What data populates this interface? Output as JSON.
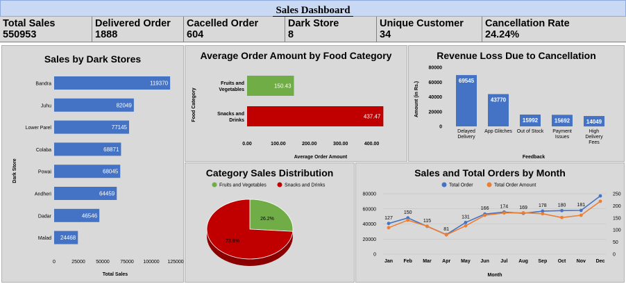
{
  "dashboard": {
    "title": "Sales Dashboard"
  },
  "kpis": [
    {
      "label": "Total Sales",
      "value": "550953"
    },
    {
      "label": "Delivered Order",
      "value": "1888"
    },
    {
      "label": "Cacelled Order",
      "value": "604"
    },
    {
      "label": "Dark Store",
      "value": "8"
    },
    {
      "label": "Unique Customer",
      "value": "34"
    },
    {
      "label": "Cancellation Rate",
      "value": "24.24%"
    }
  ],
  "colors": {
    "blue": "#4472c4",
    "red": "#c00000",
    "green": "#70ad47",
    "orange": "#ed7d31",
    "panel": "#d9d9d9",
    "title_bar": "#c9d9f3"
  },
  "chart_data": [
    {
      "id": "sales-by-dark-stores",
      "type": "bar",
      "orientation": "horizontal",
      "title": "Sales by Dark Stores",
      "xlabel": "Total Sales",
      "ylabel": "Dark Store",
      "categories": [
        "Bandra",
        "Juhu",
        "Lower Parel",
        "Colaba",
        "Powai",
        "Andheri",
        "Dadar",
        "Malad"
      ],
      "values": [
        119370,
        82049,
        77145,
        68871,
        68045,
        64459,
        46546,
        24468
      ],
      "xlim": [
        0,
        125000
      ],
      "xticks": [
        "0",
        "25000",
        "50000",
        "75000",
        "100000",
        "125000"
      ],
      "color": "#4472c4"
    },
    {
      "id": "avg-order-amount",
      "type": "bar",
      "orientation": "horizontal",
      "title": "Average Order Amount by Food Category",
      "xlabel": "Average Order Amount",
      "ylabel": "Food Category",
      "categories": [
        "Fruits and Vegetables",
        "Snacks and Drinks"
      ],
      "category_lines": [
        [
          "Fruits and",
          "Vegetables"
        ],
        [
          "Snacks and",
          "Drinks"
        ]
      ],
      "values": [
        150.43,
        437.47
      ],
      "value_labels": [
        "150.43",
        "437.47"
      ],
      "colors": [
        "#70ad47",
        "#c00000"
      ],
      "xlim": [
        0,
        450
      ],
      "xticks": [
        "0.00",
        "100.00",
        "200.00",
        "300.00",
        "400.00"
      ]
    },
    {
      "id": "revenue-loss",
      "type": "bar",
      "orientation": "vertical",
      "title": "Revenue Loss Due to Cancellation",
      "xlabel": "Feedback",
      "ylabel": "Amount (in Rs.)",
      "categories": [
        "Delayed Delivery",
        "App Glitches",
        "Out of Stock",
        "Payment Issues",
        "High Delivery Fees"
      ],
      "category_lines": [
        [
          "Delayed",
          "Delivery"
        ],
        [
          "App Glitches"
        ],
        [
          "Out of Stock"
        ],
        [
          "Payment",
          "Issues"
        ],
        [
          "High",
          "Delivery",
          "Fees"
        ]
      ],
      "values": [
        69545,
        43770,
        15992,
        15692,
        14049
      ],
      "ylim": [
        0,
        80000
      ],
      "yticks": [
        "0",
        "20000",
        "40000",
        "60000",
        "80000"
      ],
      "color": "#4472c4"
    },
    {
      "id": "category-sales-distribution",
      "type": "pie",
      "title": "Category Sales Distribution",
      "labels": [
        "Fruits and Vegetables",
        "Snacks and Drinks"
      ],
      "values": [
        26.2,
        73.8
      ],
      "value_labels": [
        "26.2%",
        "73.8%"
      ],
      "colors": [
        "#70ad47",
        "#c00000"
      ],
      "legend": "top"
    },
    {
      "id": "sales-orders-by-month",
      "type": "line",
      "title": "Sales and Total Orders by Month",
      "xlabel": "Month",
      "categories": [
        "Jan",
        "Feb",
        "Mar",
        "Apr",
        "May",
        "Jun",
        "Jul",
        "Aug",
        "Sep",
        "Oct",
        "Nov",
        "Dec"
      ],
      "legend": "top",
      "series": [
        {
          "name": "Total Order",
          "axis": "right",
          "color": "#4472c4",
          "values": [
            127,
            150,
            115,
            81,
            131,
            166,
            174,
            169,
            178,
            180,
            181,
            241
          ],
          "labels": [
            "127",
            "150",
            "115",
            "81",
            "131",
            "166",
            "174",
            "169",
            "178",
            "180",
            "181",
            ""
          ]
        },
        {
          "name": "Total Order Amount",
          "axis": "left",
          "color": "#ed7d31",
          "values": [
            35000,
            45000,
            37000,
            25500,
            37500,
            51500,
            54500,
            54800,
            53500,
            48500,
            51500,
            70000
          ]
        }
      ],
      "ylim_left": [
        0,
        80000
      ],
      "yticks_left": [
        "0",
        "20000",
        "40000",
        "60000",
        "80000"
      ],
      "ylim_right": [
        0,
        250
      ],
      "yticks_right": [
        "0",
        "50",
        "100",
        "150",
        "200",
        "250"
      ]
    }
  ]
}
